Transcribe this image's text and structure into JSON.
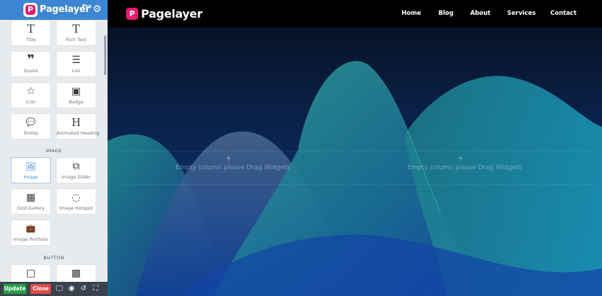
{
  "editor": {
    "brand": "Pagelayer",
    "pro": "Pro",
    "logo_letter": "P",
    "colors": {
      "header": "#3c86d3",
      "update": "#27a046",
      "close": "#e14a4a",
      "brand_pink": "#e6196d"
    }
  },
  "widgets": {
    "title": {
      "label": "Title",
      "icon": "T"
    },
    "rich_text": {
      "label": "Rich Text",
      "icon": "T"
    },
    "quote": {
      "label": "Quote",
      "icon": "❞"
    },
    "list": {
      "label": "List",
      "icon": "☰"
    },
    "icon": {
      "label": "Icon",
      "icon": "☆"
    },
    "badge": {
      "label": "Badge",
      "icon": "▣"
    },
    "tooltip": {
      "label": "Tooltip",
      "icon": "💬"
    },
    "animated_heading": {
      "label": "Animated Heading",
      "icon": "H"
    },
    "image": {
      "label": "Image",
      "icon": "🖼"
    },
    "image_slider": {
      "label": "Image Slider",
      "icon": "⧉"
    },
    "grid_gallery": {
      "label": "Grid Gallery",
      "icon": "▦"
    },
    "image_hotspot": {
      "label": "Image Hotspot",
      "icon": "◌"
    },
    "image_portfolio": {
      "label": "Image Portfolio",
      "icon": "💼"
    },
    "button_1": {
      "label": "",
      "icon": "□"
    },
    "button_2": {
      "label": "",
      "icon": "▩"
    }
  },
  "sections": {
    "image": "IMAGE",
    "button": "BUTTON"
  },
  "footer": {
    "update": "Update",
    "close": "Close"
  },
  "site": {
    "name": "Pagelayer",
    "logo_letter": "P",
    "nav": [
      "Home",
      "Blog",
      "About",
      "Services",
      "Contact"
    ]
  },
  "columns": {
    "left_text": "Empty column please Drag Widgets",
    "right_text": "Empty column please Drag Widgets",
    "plus": "+"
  }
}
